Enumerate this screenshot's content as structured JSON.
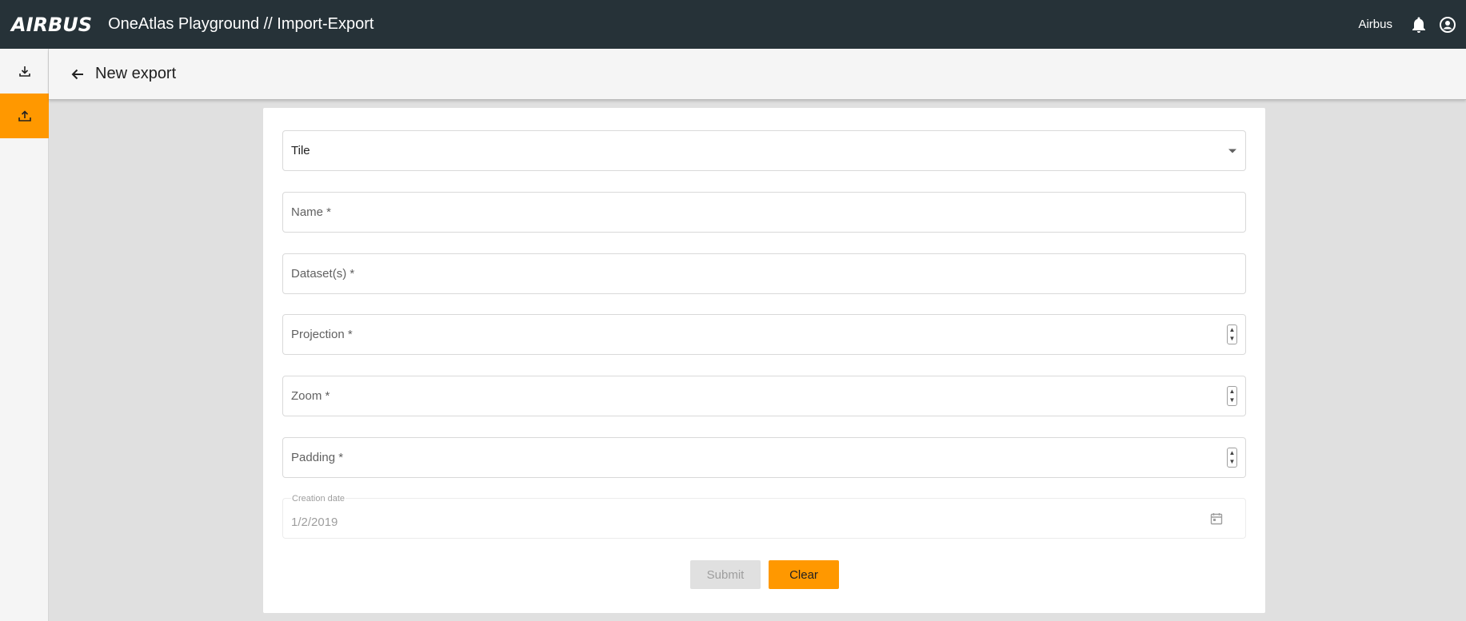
{
  "header": {
    "logo": "AIRBUS",
    "title": "OneAtlas Playground // Import-Export",
    "user": "Airbus",
    "icons": [
      "bell-icon",
      "account-circle-icon"
    ]
  },
  "sidebar": {
    "items": [
      {
        "name": "import",
        "icon": "download-icon",
        "active": false
      },
      {
        "name": "export",
        "icon": "upload-icon",
        "active": true
      }
    ]
  },
  "subheader": {
    "back_icon": "arrow-left-icon",
    "title": "New export"
  },
  "form": {
    "type_select": {
      "value": "Tile",
      "icon": "caret-down-icon"
    },
    "name": {
      "label": "Name *"
    },
    "datasets": {
      "label": "Dataset(s) *"
    },
    "projection": {
      "label": "Projection *"
    },
    "zoom": {
      "label": "Zoom *"
    },
    "padding": {
      "label": "Padding *"
    },
    "creation_date": {
      "label": "Creation date",
      "value": "1/2/2019",
      "icon": "calendar-icon"
    },
    "submit_label": "Submit",
    "clear_label": "Clear"
  },
  "colors": {
    "topbar": "#263238",
    "accent": "#ff9800",
    "background": "#e0e0e0"
  }
}
